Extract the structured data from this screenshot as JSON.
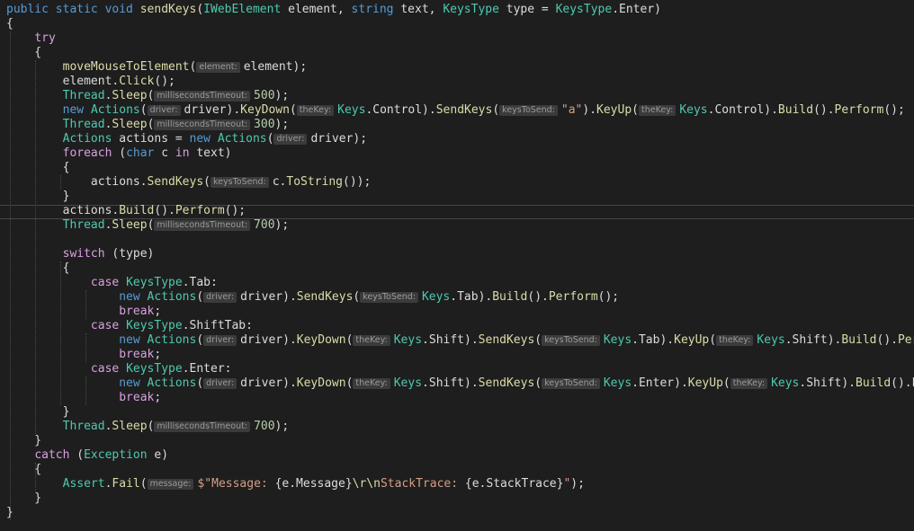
{
  "editor": {
    "lines": [
      [
        {
          "t": "public static void ",
          "c": "kw"
        },
        {
          "t": "sendKeys",
          "c": "method"
        },
        {
          "t": "(",
          "c": "plain"
        },
        {
          "t": "IWebElement",
          "c": "type"
        },
        {
          "t": " element, ",
          "c": "plain"
        },
        {
          "t": "string",
          "c": "kw"
        },
        {
          "t": " text, ",
          "c": "plain"
        },
        {
          "t": "KeysType",
          "c": "type"
        },
        {
          "t": " type = ",
          "c": "plain"
        },
        {
          "t": "KeysType",
          "c": "type"
        },
        {
          "t": ".Enter)",
          "c": "plain"
        }
      ],
      [
        {
          "t": "{",
          "c": "plain"
        }
      ],
      [
        {
          "t": "    ",
          "c": "plain"
        },
        {
          "t": "try",
          "c": "ctrl"
        }
      ],
      [
        {
          "t": "    {",
          "c": "plain"
        }
      ],
      [
        {
          "t": "        ",
          "c": "plain"
        },
        {
          "t": "moveMouseToElement",
          "c": "method"
        },
        {
          "t": "(",
          "c": "plain"
        },
        {
          "h": "element:"
        },
        {
          "t": "element);",
          "c": "plain"
        }
      ],
      [
        {
          "t": "        element.",
          "c": "plain"
        },
        {
          "t": "Click",
          "c": "method"
        },
        {
          "t": "();",
          "c": "plain"
        }
      ],
      [
        {
          "t": "        ",
          "c": "plain"
        },
        {
          "t": "Thread",
          "c": "type"
        },
        {
          "t": ".",
          "c": "plain"
        },
        {
          "t": "Sleep",
          "c": "method"
        },
        {
          "t": "(",
          "c": "plain"
        },
        {
          "h": "millisecondsTimeout:"
        },
        {
          "t": "500",
          "c": "num"
        },
        {
          "t": ");",
          "c": "plain"
        }
      ],
      [
        {
          "t": "        ",
          "c": "plain"
        },
        {
          "t": "new ",
          "c": "kw"
        },
        {
          "t": "Actions",
          "c": "type"
        },
        {
          "t": "(",
          "c": "plain"
        },
        {
          "h": "driver:"
        },
        {
          "t": "driver).",
          "c": "plain"
        },
        {
          "t": "KeyDown",
          "c": "method"
        },
        {
          "t": "(",
          "c": "plain"
        },
        {
          "h": "theKey:"
        },
        {
          "t": "Keys",
          "c": "type"
        },
        {
          "t": ".Control).",
          "c": "plain"
        },
        {
          "t": "SendKeys",
          "c": "method"
        },
        {
          "t": "(",
          "c": "plain"
        },
        {
          "h": "keysToSend:"
        },
        {
          "t": "\"a\"",
          "c": "str"
        },
        {
          "t": ").",
          "c": "plain"
        },
        {
          "t": "KeyUp",
          "c": "method"
        },
        {
          "t": "(",
          "c": "plain"
        },
        {
          "h": "theKey:"
        },
        {
          "t": "Keys",
          "c": "type"
        },
        {
          "t": ".Control).",
          "c": "plain"
        },
        {
          "t": "Build",
          "c": "method"
        },
        {
          "t": "().",
          "c": "plain"
        },
        {
          "t": "Perform",
          "c": "method"
        },
        {
          "t": "();",
          "c": "plain"
        }
      ],
      [
        {
          "t": "        ",
          "c": "plain"
        },
        {
          "t": "Thread",
          "c": "type"
        },
        {
          "t": ".",
          "c": "plain"
        },
        {
          "t": "Sleep",
          "c": "method"
        },
        {
          "t": "(",
          "c": "plain"
        },
        {
          "h": "millisecondsTimeout:"
        },
        {
          "t": "300",
          "c": "num"
        },
        {
          "t": ");",
          "c": "plain"
        }
      ],
      [
        {
          "t": "        ",
          "c": "plain"
        },
        {
          "t": "Actions",
          "c": "type"
        },
        {
          "t": " actions = ",
          "c": "plain"
        },
        {
          "t": "new ",
          "c": "kw"
        },
        {
          "t": "Actions",
          "c": "type"
        },
        {
          "t": "(",
          "c": "plain"
        },
        {
          "h": "driver:"
        },
        {
          "t": "driver);",
          "c": "plain"
        }
      ],
      [
        {
          "t": "        ",
          "c": "plain"
        },
        {
          "t": "foreach",
          "c": "ctrl"
        },
        {
          "t": " (",
          "c": "plain"
        },
        {
          "t": "char",
          "c": "kw"
        },
        {
          "t": " c ",
          "c": "plain"
        },
        {
          "t": "in",
          "c": "ctrl"
        },
        {
          "t": " text)",
          "c": "plain"
        }
      ],
      [
        {
          "t": "        {",
          "c": "plain"
        }
      ],
      [
        {
          "t": "            actions.",
          "c": "plain"
        },
        {
          "t": "SendKeys",
          "c": "method"
        },
        {
          "t": "(",
          "c": "plain"
        },
        {
          "h": "keysToSend:"
        },
        {
          "t": "c.",
          "c": "plain"
        },
        {
          "t": "ToString",
          "c": "method"
        },
        {
          "t": "());",
          "c": "plain"
        }
      ],
      [
        {
          "t": "        }",
          "c": "plain"
        }
      ],
      [
        {
          "t": "        actions.",
          "c": "plain"
        },
        {
          "t": "Build",
          "c": "method"
        },
        {
          "t": "().",
          "c": "plain"
        },
        {
          "t": "Perform",
          "c": "method"
        },
        {
          "t": "();",
          "c": "plain"
        }
      ],
      [
        {
          "t": "        ",
          "c": "plain"
        },
        {
          "t": "Thread",
          "c": "type"
        },
        {
          "t": ".",
          "c": "plain"
        },
        {
          "t": "Sleep",
          "c": "method"
        },
        {
          "t": "(",
          "c": "plain"
        },
        {
          "h": "millisecondsTimeout:"
        },
        {
          "t": "700",
          "c": "num"
        },
        {
          "t": ");",
          "c": "plain"
        }
      ],
      [],
      [
        {
          "t": "        ",
          "c": "plain"
        },
        {
          "t": "switch",
          "c": "ctrl"
        },
        {
          "t": " (type)",
          "c": "plain"
        }
      ],
      [
        {
          "t": "        {",
          "c": "plain"
        }
      ],
      [
        {
          "t": "            ",
          "c": "plain"
        },
        {
          "t": "case",
          "c": "ctrl"
        },
        {
          "t": " ",
          "c": "plain"
        },
        {
          "t": "KeysType",
          "c": "type"
        },
        {
          "t": ".Tab:",
          "c": "plain"
        }
      ],
      [
        {
          "t": "                ",
          "c": "plain"
        },
        {
          "t": "new ",
          "c": "kw"
        },
        {
          "t": "Actions",
          "c": "type"
        },
        {
          "t": "(",
          "c": "plain"
        },
        {
          "h": "driver:"
        },
        {
          "t": "driver).",
          "c": "plain"
        },
        {
          "t": "SendKeys",
          "c": "method"
        },
        {
          "t": "(",
          "c": "plain"
        },
        {
          "h": "keysToSend:"
        },
        {
          "t": "Keys",
          "c": "type"
        },
        {
          "t": ".Tab).",
          "c": "plain"
        },
        {
          "t": "Build",
          "c": "method"
        },
        {
          "t": "().",
          "c": "plain"
        },
        {
          "t": "Perform",
          "c": "method"
        },
        {
          "t": "();",
          "c": "plain"
        }
      ],
      [
        {
          "t": "                ",
          "c": "plain"
        },
        {
          "t": "break",
          "c": "ctrl"
        },
        {
          "t": ";",
          "c": "plain"
        }
      ],
      [
        {
          "t": "            ",
          "c": "plain"
        },
        {
          "t": "case",
          "c": "ctrl"
        },
        {
          "t": " ",
          "c": "plain"
        },
        {
          "t": "KeysType",
          "c": "type"
        },
        {
          "t": ".ShiftTab:",
          "c": "plain"
        }
      ],
      [
        {
          "t": "                ",
          "c": "plain"
        },
        {
          "t": "new ",
          "c": "kw"
        },
        {
          "t": "Actions",
          "c": "type"
        },
        {
          "t": "(",
          "c": "plain"
        },
        {
          "h": "driver:"
        },
        {
          "t": "driver).",
          "c": "plain"
        },
        {
          "t": "KeyDown",
          "c": "method"
        },
        {
          "t": "(",
          "c": "plain"
        },
        {
          "h": "theKey:"
        },
        {
          "t": "Keys",
          "c": "type"
        },
        {
          "t": ".Shift).",
          "c": "plain"
        },
        {
          "t": "SendKeys",
          "c": "method"
        },
        {
          "t": "(",
          "c": "plain"
        },
        {
          "h": "keysToSend:"
        },
        {
          "t": "Keys",
          "c": "type"
        },
        {
          "t": ".Tab).",
          "c": "plain"
        },
        {
          "t": "KeyUp",
          "c": "method"
        },
        {
          "t": "(",
          "c": "plain"
        },
        {
          "h": "theKey:"
        },
        {
          "t": "Keys",
          "c": "type"
        },
        {
          "t": ".Shift).",
          "c": "plain"
        },
        {
          "t": "Build",
          "c": "method"
        },
        {
          "t": "().",
          "c": "plain"
        },
        {
          "t": "Perform",
          "c": "method"
        },
        {
          "t": "();",
          "c": "plain"
        }
      ],
      [
        {
          "t": "                ",
          "c": "plain"
        },
        {
          "t": "break",
          "c": "ctrl"
        },
        {
          "t": ";",
          "c": "plain"
        }
      ],
      [
        {
          "t": "            ",
          "c": "plain"
        },
        {
          "t": "case",
          "c": "ctrl"
        },
        {
          "t": " ",
          "c": "plain"
        },
        {
          "t": "KeysType",
          "c": "type"
        },
        {
          "t": ".Enter:",
          "c": "plain"
        }
      ],
      [
        {
          "t": "                ",
          "c": "plain"
        },
        {
          "t": "new ",
          "c": "kw"
        },
        {
          "t": "Actions",
          "c": "type"
        },
        {
          "t": "(",
          "c": "plain"
        },
        {
          "h": "driver:"
        },
        {
          "t": "driver).",
          "c": "plain"
        },
        {
          "t": "KeyDown",
          "c": "method"
        },
        {
          "t": "(",
          "c": "plain"
        },
        {
          "h": "theKey:"
        },
        {
          "t": "Keys",
          "c": "type"
        },
        {
          "t": ".Shift).",
          "c": "plain"
        },
        {
          "t": "SendKeys",
          "c": "method"
        },
        {
          "t": "(",
          "c": "plain"
        },
        {
          "h": "keysToSend:"
        },
        {
          "t": "Keys",
          "c": "type"
        },
        {
          "t": ".Enter).",
          "c": "plain"
        },
        {
          "t": "KeyUp",
          "c": "method"
        },
        {
          "t": "(",
          "c": "plain"
        },
        {
          "h": "theKey:"
        },
        {
          "t": "Keys",
          "c": "type"
        },
        {
          "t": ".Shift).",
          "c": "plain"
        },
        {
          "t": "Build",
          "c": "method"
        },
        {
          "t": "().",
          "c": "plain"
        },
        {
          "t": "Perform",
          "c": "method"
        },
        {
          "t": "();",
          "c": "plain"
        }
      ],
      [
        {
          "t": "                ",
          "c": "plain"
        },
        {
          "t": "break",
          "c": "ctrl"
        },
        {
          "t": ";",
          "c": "plain"
        }
      ],
      [
        {
          "t": "        }",
          "c": "plain"
        }
      ],
      [
        {
          "t": "        ",
          "c": "plain"
        },
        {
          "t": "Thread",
          "c": "type"
        },
        {
          "t": ".",
          "c": "plain"
        },
        {
          "t": "Sleep",
          "c": "method"
        },
        {
          "t": "(",
          "c": "plain"
        },
        {
          "h": "millisecondsTimeout:"
        },
        {
          "t": "700",
          "c": "num"
        },
        {
          "t": ");",
          "c": "plain"
        }
      ],
      [
        {
          "t": "    }",
          "c": "plain"
        }
      ],
      [
        {
          "t": "    ",
          "c": "plain"
        },
        {
          "t": "catch",
          "c": "ctrl"
        },
        {
          "t": " (",
          "c": "plain"
        },
        {
          "t": "Exception",
          "c": "type"
        },
        {
          "t": " e)",
          "c": "plain"
        }
      ],
      [
        {
          "t": "    {",
          "c": "plain"
        }
      ],
      [
        {
          "t": "        ",
          "c": "plain"
        },
        {
          "t": "Assert",
          "c": "type"
        },
        {
          "t": ".",
          "c": "plain"
        },
        {
          "t": "Fail",
          "c": "method"
        },
        {
          "t": "(",
          "c": "plain"
        },
        {
          "h": "message:"
        },
        {
          "t": "$\"Message: ",
          "c": "str"
        },
        {
          "t": "{e.Message}",
          "c": "plain"
        },
        {
          "t": "\\r\\n",
          "c": "method"
        },
        {
          "t": "StackTrace: ",
          "c": "str"
        },
        {
          "t": "{e.StackTrace}",
          "c": "plain"
        },
        {
          "t": "\"",
          "c": "str"
        },
        {
          "t": ");",
          "c": "plain"
        }
      ],
      [
        {
          "t": "    }",
          "c": "plain"
        }
      ],
      [
        {
          "t": "}",
          "c": "plain"
        }
      ]
    ]
  },
  "colors": {
    "background": "#1e1e1e",
    "kw": "#569cd6",
    "ctrl": "#d8a0df",
    "type": "#4ec9b0",
    "method": "#dcdcaa",
    "str": "#d69d85",
    "num": "#b5cea8",
    "plain": "#dcdcdc",
    "hint_bg": "#3b3b3b",
    "hint_fg": "#9a9a9a"
  }
}
